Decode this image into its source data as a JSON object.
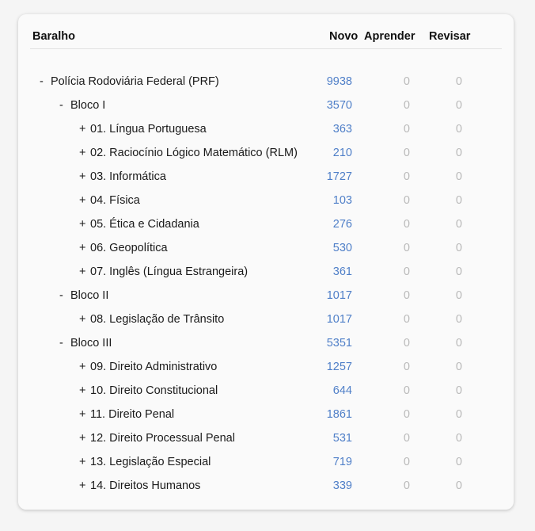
{
  "header": {
    "deck": "Baralho",
    "new": "Novo",
    "learn": "Aprender",
    "review": "Revisar"
  },
  "colors": {
    "new": "#4f7fc8",
    "zero": "#b9b9b9"
  },
  "decks": [
    {
      "toggle": "-",
      "name": "Polícia Rodoviária Federal (PRF)",
      "new": "9938",
      "learn": "0",
      "review": "0"
    },
    {
      "toggle": "-",
      "name": "Bloco I",
      "new": "3570",
      "learn": "0",
      "review": "0"
    },
    {
      "toggle": "+",
      "name": "01. Língua Portuguesa",
      "new": "363",
      "learn": "0",
      "review": "0"
    },
    {
      "toggle": "+",
      "name": "02. Raciocínio Lógico Matemático (RLM)",
      "new": "210",
      "learn": "0",
      "review": "0"
    },
    {
      "toggle": "+",
      "name": "03. Informática",
      "new": "1727",
      "learn": "0",
      "review": "0"
    },
    {
      "toggle": "+",
      "name": "04. Física",
      "new": "103",
      "learn": "0",
      "review": "0"
    },
    {
      "toggle": "+",
      "name": "05. Ética e Cidadania",
      "new": "276",
      "learn": "0",
      "review": "0"
    },
    {
      "toggle": "+",
      "name": "06. Geopolítica",
      "new": "530",
      "learn": "0",
      "review": "0"
    },
    {
      "toggle": "+",
      "name": "07. Inglês (Língua Estrangeira)",
      "new": "361",
      "learn": "0",
      "review": "0"
    },
    {
      "toggle": "-",
      "name": "Bloco II",
      "new": "1017",
      "learn": "0",
      "review": "0"
    },
    {
      "toggle": "+",
      "name": "08. Legislação de Trânsito",
      "new": "1017",
      "learn": "0",
      "review": "0"
    },
    {
      "toggle": "-",
      "name": "Bloco III",
      "new": "5351",
      "learn": "0",
      "review": "0"
    },
    {
      "toggle": "+",
      "name": "09. Direito Administrativo",
      "new": "1257",
      "learn": "0",
      "review": "0"
    },
    {
      "toggle": "+",
      "name": "10. Direito Constitucional",
      "new": "644",
      "learn": "0",
      "review": "0"
    },
    {
      "toggle": "+",
      "name": "11. Direito Penal",
      "new": "1861",
      "learn": "0",
      "review": "0"
    },
    {
      "toggle": "+",
      "name": "12. Direito Processual Penal",
      "new": "531",
      "learn": "0",
      "review": "0"
    },
    {
      "toggle": "+",
      "name": "13. Legislação Especial",
      "new": "719",
      "learn": "0",
      "review": "0"
    },
    {
      "toggle": "+",
      "name": "14. Direitos Humanos",
      "new": "339",
      "learn": "0",
      "review": "0"
    }
  ]
}
